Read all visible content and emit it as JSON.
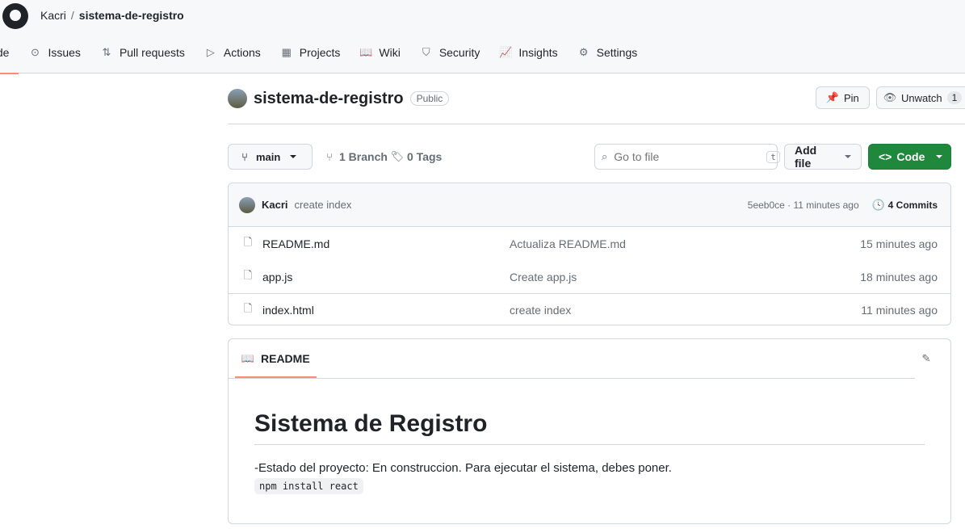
{
  "header": {
    "owner": "Kacri",
    "separator": "/",
    "repo": "sistema-de-registro"
  },
  "nav": [
    {
      "label": "Code",
      "icon": "code-icon",
      "glyph": ""
    },
    {
      "label": "Issues",
      "icon": "issue-icon",
      "glyph": "⊙"
    },
    {
      "label": "Pull requests",
      "icon": "pull-request-icon",
      "glyph": "⇅"
    },
    {
      "label": "Actions",
      "icon": "play-icon",
      "glyph": "▷"
    },
    {
      "label": "Projects",
      "icon": "table-icon",
      "glyph": "▦"
    },
    {
      "label": "Wiki",
      "icon": "book-icon",
      "glyph": "📖"
    },
    {
      "label": "Security",
      "icon": "shield-icon",
      "glyph": "⛉"
    },
    {
      "label": "Insights",
      "icon": "graph-icon",
      "glyph": "📈"
    },
    {
      "label": "Settings",
      "icon": "gear-icon",
      "glyph": "⚙"
    }
  ],
  "repo": {
    "name": "sistema-de-registro",
    "visibility": "Public",
    "pin": "Pin",
    "unwatch": "Unwatch",
    "watch_count": "1"
  },
  "toolbar": {
    "branch": "main",
    "branches": "1 Branch",
    "tags": "0 Tags",
    "search_placeholder": "Go to file",
    "shortcut": "t",
    "add_file": "Add file",
    "code": "Code"
  },
  "commit": {
    "author": "Kacri",
    "message": "create index",
    "hash_time": "5eeb0ce · 11 minutes ago",
    "commits": "4 Commits"
  },
  "files": [
    {
      "name": "README.md",
      "message": "Actualiza README.md",
      "time": "15 minutes ago"
    },
    {
      "name": "app.js",
      "message": "Create app.js",
      "time": "18 minutes ago"
    },
    {
      "name": "index.html",
      "message": "create index",
      "time": "11 minutes ago"
    }
  ],
  "readme": {
    "tab": "README",
    "title": "Sistema de Registro",
    "text": "-Estado del proyecto: En construccion. Para ejecutar el sistema, debes poner.",
    "code": "npm install react"
  },
  "colors": {
    "accent": "#fd8c73",
    "primary": "#1f883d"
  }
}
